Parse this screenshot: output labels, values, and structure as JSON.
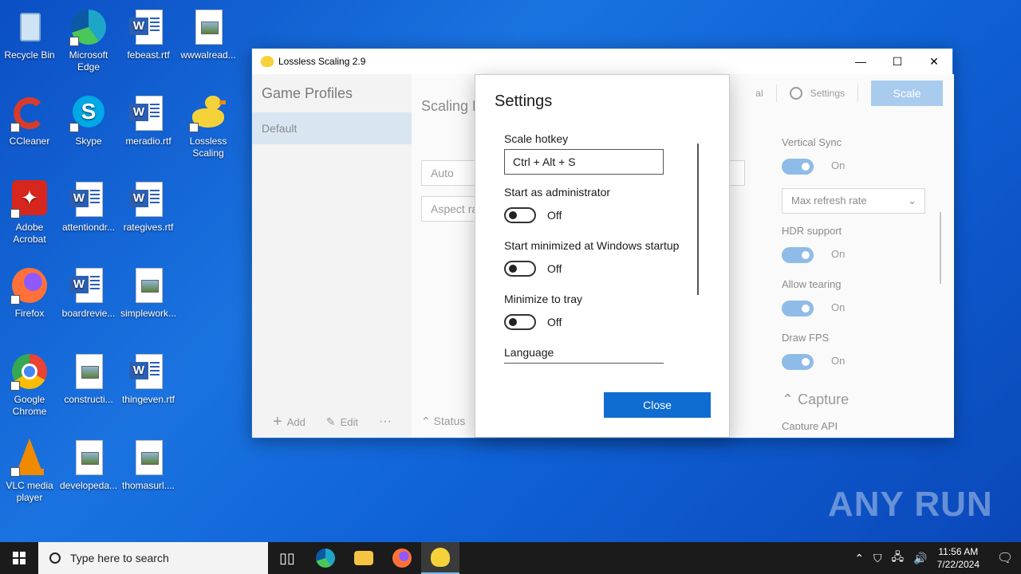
{
  "desktop_icons": [
    {
      "label": "Recycle Bin",
      "icon": "recycle-bin-icon",
      "color": "#9ec3e6"
    },
    {
      "label": "Microsoft Edge",
      "icon": "edge-icon",
      "color": "#1ea6c9"
    },
    {
      "label": "febeast.rtf",
      "icon": "word-doc-icon",
      "color": "#2b5fb4"
    },
    {
      "label": "wwwalread...",
      "icon": "image-file-icon",
      "color": "#8fb7d6"
    },
    {
      "label": "CCleaner",
      "icon": "ccleaner-icon",
      "color": "#d93b2b"
    },
    {
      "label": "Skype",
      "icon": "skype-icon",
      "color": "#00a8e6"
    },
    {
      "label": "meradio.rtf",
      "icon": "word-doc-icon",
      "color": "#2b5fb4"
    },
    {
      "label": "Lossless Scaling",
      "icon": "lossless-scaling-icon",
      "color": "#f5d23a"
    },
    {
      "label": "Adobe Acrobat",
      "icon": "acrobat-icon",
      "color": "#d7261e"
    },
    {
      "label": "attentiondr...",
      "icon": "word-doc-icon",
      "color": "#2b5fb4"
    },
    {
      "label": "rategives.rtf",
      "icon": "word-doc-icon",
      "color": "#2b5fb4"
    },
    {
      "label": "Firefox",
      "icon": "firefox-icon",
      "color": "#ff7139"
    },
    {
      "label": "boardrevie...",
      "icon": "word-doc-icon",
      "color": "#2b5fb4"
    },
    {
      "label": "simplework...",
      "icon": "image-file-icon",
      "color": "#8fb7d6"
    },
    {
      "label": "Google Chrome",
      "icon": "chrome-icon",
      "color": "#34a853"
    },
    {
      "label": "constructi...",
      "icon": "image-file-icon",
      "color": "#8fb7d6"
    },
    {
      "label": "thingeven.rtf",
      "icon": "word-doc-icon",
      "color": "#2b5fb4"
    },
    {
      "label": "VLC media player",
      "icon": "vlc-icon",
      "color": "#f08a00"
    },
    {
      "label": "developeda...",
      "icon": "image-file-icon",
      "color": "#8fb7d6"
    },
    {
      "label": "thomasurl....",
      "icon": "image-file-icon",
      "color": "#8fb7d6"
    }
  ],
  "window": {
    "title": "Lossless Scaling 2.9",
    "minimize": "—",
    "maximize": "☐",
    "close": "✕"
  },
  "sidebar": {
    "heading": "Game Profiles",
    "profile": "Default",
    "add_label": "Add",
    "edit_label": "Edit",
    "more_label": "···"
  },
  "main": {
    "section_title": "Scaling M",
    "select1": "Auto",
    "select2": "Aspect ra",
    "status": "Status",
    "nav_partial": "al",
    "settings_label": "Settings",
    "scale_label": "Scale"
  },
  "right_panel": {
    "vsync_label": "Vertical Sync",
    "vsync_state": "On",
    "refresh_select": "Max refresh rate",
    "hdr_label": "HDR support",
    "hdr_state": "On",
    "tearing_label": "Allow tearing",
    "tearing_state": "On",
    "fps_label": "Draw FPS",
    "fps_state": "On",
    "capture_section": "Capture",
    "capture_api": "Capture API"
  },
  "dialog": {
    "title": "Settings",
    "hotkey_label": "Scale hotkey",
    "hotkey_value": "Ctrl + Alt + S",
    "admin_label": "Start as administrator",
    "admin_state": "Off",
    "minimized_label": "Start minimized at Windows startup",
    "minimized_state": "Off",
    "tray_label": "Minimize to tray",
    "tray_state": "Off",
    "language_label": "Language",
    "close_label": "Close"
  },
  "watermark": "ANY RUN",
  "taskbar": {
    "search_placeholder": "Type here to search",
    "time": "11:56 AM",
    "date": "7/22/2024"
  }
}
